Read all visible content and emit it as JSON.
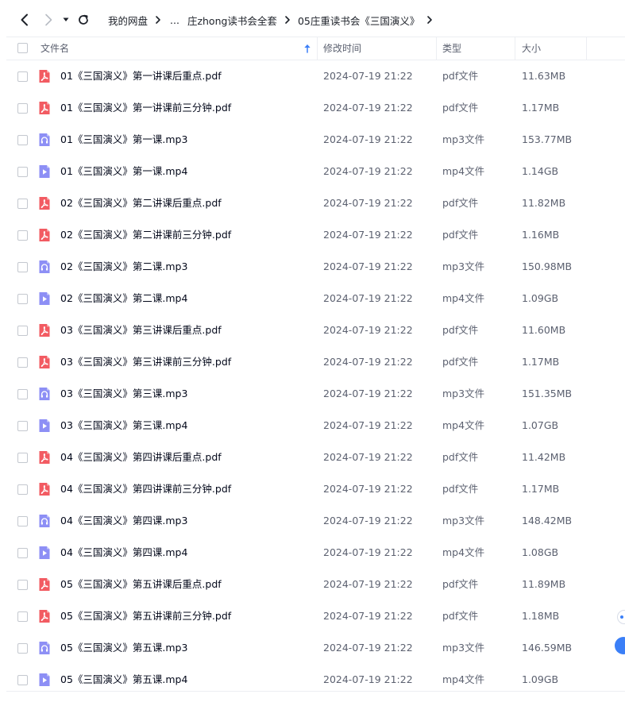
{
  "nav": {
    "back_icon": "chevron-left-icon",
    "forward_icon": "chevron-right-icon",
    "history_icon": "caret-down-icon",
    "refresh_icon": "refresh-icon"
  },
  "breadcrumb": {
    "root": "我的网盘",
    "ellipsis": "...",
    "items": [
      "庄zhong读书会全套",
      "05庄重读书会《三国演义》"
    ]
  },
  "columns": {
    "name": "文件名",
    "modified": "修改时间",
    "type": "类型",
    "size": "大小"
  },
  "colors": {
    "pdf_icon": "#f25b62",
    "audio_icon": "#8d8ff5",
    "video_icon": "#8d8ff5",
    "accent": "#3b7ff7"
  },
  "files": [
    {
      "name": "01《三国演义》第一讲课后重点.pdf",
      "modified": "2024-07-19 21:22",
      "type": "pdf文件",
      "size": "11.63MB",
      "icon": "pdf-icon"
    },
    {
      "name": "01《三国演义》第一讲课前三分钟.pdf",
      "modified": "2024-07-19 21:22",
      "type": "pdf文件",
      "size": "1.17MB",
      "icon": "pdf-icon"
    },
    {
      "name": "01《三国演义》第一课.mp3",
      "modified": "2024-07-19 21:22",
      "type": "mp3文件",
      "size": "153.77MB",
      "icon": "audio-icon"
    },
    {
      "name": "01《三国演义》第一课.mp4",
      "modified": "2024-07-19 21:22",
      "type": "mp4文件",
      "size": "1.14GB",
      "icon": "video-icon"
    },
    {
      "name": "02《三国演义》第二讲课后重点.pdf",
      "modified": "2024-07-19 21:22",
      "type": "pdf文件",
      "size": "11.82MB",
      "icon": "pdf-icon"
    },
    {
      "name": "02《三国演义》第二讲课前三分钟.pdf",
      "modified": "2024-07-19 21:22",
      "type": "pdf文件",
      "size": "1.16MB",
      "icon": "pdf-icon"
    },
    {
      "name": "02《三国演义》第二课.mp3",
      "modified": "2024-07-19 21:22",
      "type": "mp3文件",
      "size": "150.98MB",
      "icon": "audio-icon"
    },
    {
      "name": "02《三国演义》第二课.mp4",
      "modified": "2024-07-19 21:22",
      "type": "mp4文件",
      "size": "1.09GB",
      "icon": "video-icon"
    },
    {
      "name": "03《三国演义》第三讲课后重点.pdf",
      "modified": "2024-07-19 21:22",
      "type": "pdf文件",
      "size": "11.60MB",
      "icon": "pdf-icon"
    },
    {
      "name": "03《三国演义》第三讲课前三分钟.pdf",
      "modified": "2024-07-19 21:22",
      "type": "pdf文件",
      "size": "1.17MB",
      "icon": "pdf-icon"
    },
    {
      "name": "03《三国演义》第三课.mp3",
      "modified": "2024-07-19 21:22",
      "type": "mp3文件",
      "size": "151.35MB",
      "icon": "audio-icon"
    },
    {
      "name": "03《三国演义》第三课.mp4",
      "modified": "2024-07-19 21:22",
      "type": "mp4文件",
      "size": "1.07GB",
      "icon": "video-icon"
    },
    {
      "name": "04《三国演义》第四讲课后重点.pdf",
      "modified": "2024-07-19 21:22",
      "type": "pdf文件",
      "size": "11.42MB",
      "icon": "pdf-icon"
    },
    {
      "name": "04《三国演义》第四讲课前三分钟.pdf",
      "modified": "2024-07-19 21:22",
      "type": "pdf文件",
      "size": "1.17MB",
      "icon": "pdf-icon"
    },
    {
      "name": "04《三国演义》第四课.mp3",
      "modified": "2024-07-19 21:22",
      "type": "mp3文件",
      "size": "148.42MB",
      "icon": "audio-icon"
    },
    {
      "name": "04《三国演义》第四课.mp4",
      "modified": "2024-07-19 21:22",
      "type": "mp4文件",
      "size": "1.08GB",
      "icon": "video-icon"
    },
    {
      "name": "05《三国演义》第五讲课后重点.pdf",
      "modified": "2024-07-19 21:22",
      "type": "pdf文件",
      "size": "11.89MB",
      "icon": "pdf-icon"
    },
    {
      "name": "05《三国演义》第五讲课前三分钟.pdf",
      "modified": "2024-07-19 21:22",
      "type": "pdf文件",
      "size": "1.18MB",
      "icon": "pdf-icon"
    },
    {
      "name": "05《三国演义》第五课.mp3",
      "modified": "2024-07-19 21:22",
      "type": "mp3文件",
      "size": "146.59MB",
      "icon": "audio-icon"
    },
    {
      "name": "05《三国演义》第五课.mp4",
      "modified": "2024-07-19 21:22",
      "type": "mp4文件",
      "size": "1.09GB",
      "icon": "video-icon"
    }
  ]
}
